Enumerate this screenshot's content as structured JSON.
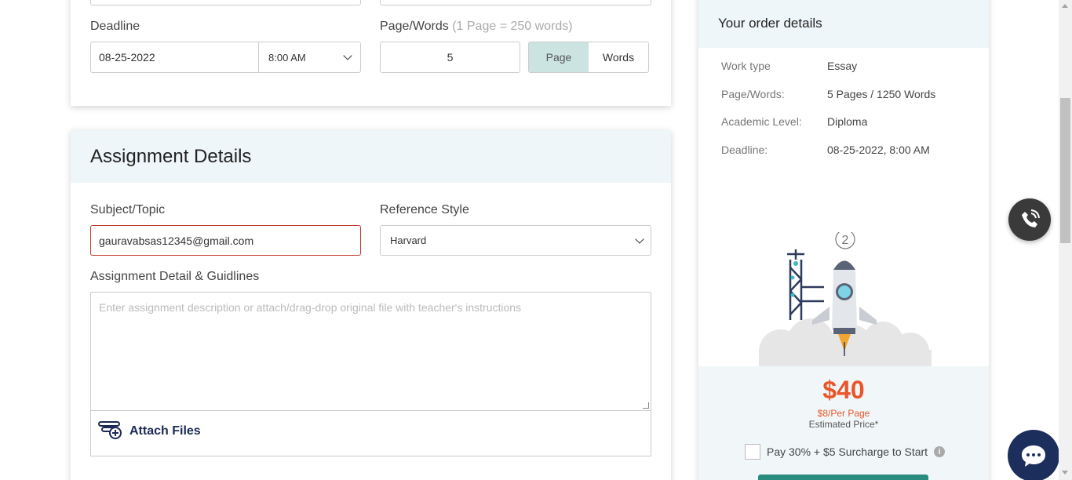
{
  "order_form": {
    "deadline": {
      "label": "Deadline",
      "date_value": "08-25-2022",
      "time_value": "8:00 AM"
    },
    "page_words": {
      "label": "Page/Words",
      "hint": "(1 Page = 250 words)",
      "value": "5",
      "toggle_page": "Page",
      "toggle_words": "Words"
    }
  },
  "assignment": {
    "title": "Assignment Details",
    "subject_label": "Subject/Topic",
    "subject_value": "gauravabsas12345@gmail.com",
    "reference_label": "Reference Style",
    "reference_value": "Harvard",
    "detail_label": "Assignment Detail & Guidlines",
    "detail_placeholder": "Enter assignment description or attach/drag-drop original file with teacher's instructions",
    "attach_label": "Attach Files"
  },
  "order_details": {
    "title": "Your order details",
    "rows": [
      {
        "key": "Work type",
        "value": "Essay"
      },
      {
        "key": "Page/Words:",
        "value": "5 Pages / 1250 Words"
      },
      {
        "key": "Academic Level:",
        "value": "Diploma"
      },
      {
        "key": "Deadline:",
        "value": "08-25-2022, 8:00 AM"
      }
    ],
    "step_number": "2",
    "price": "$40",
    "per_page": "$8/Per Page",
    "estimated": "Estimated Price*",
    "surcharge": "Pay 30% + $5 Surcharge to Start"
  },
  "colors": {
    "price": "#e8562a",
    "accent_toggle": "#cbe4e1",
    "header_band": "#eef6f9",
    "chat": "#1c2f5c"
  },
  "icons": [
    "chevron-down-icon",
    "attach-files-icon",
    "rocket-illustration",
    "phone-icon",
    "chat-icon",
    "info-icon"
  ]
}
